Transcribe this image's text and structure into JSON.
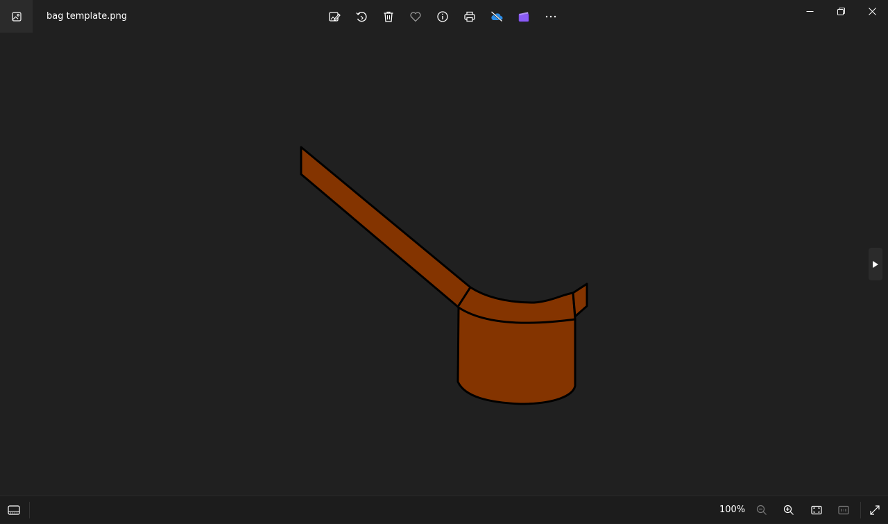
{
  "window": {
    "file_name": "bag template.png"
  },
  "toolbar": {
    "items": [
      {
        "icon": "edit-image-icon"
      },
      {
        "icon": "rotate-icon"
      },
      {
        "icon": "delete-icon"
      },
      {
        "icon": "favorite-heart-icon"
      },
      {
        "icon": "info-icon"
      },
      {
        "icon": "print-icon"
      },
      {
        "icon": "onedrive-cloud-icon"
      },
      {
        "icon": "clipchamp-icon"
      },
      {
        "icon": "more-options-icon"
      }
    ]
  },
  "status": {
    "zoom_level": "100%"
  },
  "colors": {
    "background": "#202020",
    "bag_fill": "#843400",
    "bag_outline": "#000000",
    "onedrive_blue": "#2b8ce6",
    "clipchamp_purple": "#8b5cf6"
  }
}
